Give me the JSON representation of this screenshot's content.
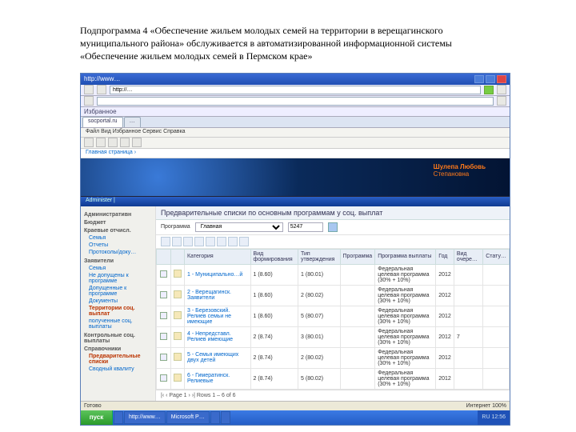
{
  "caption": "Подпрограмма 4 «Обеспечение жильем молодых семей на территории в верещагинского муниципального района»  обслуживается в автоматизированной информационной системы «Обеспечение жильем молодых семей в Пермском крае»",
  "titlebar": "http://www…",
  "address_value": "http://…",
  "fav_label": "Избранное",
  "tabs": [
    "socportal.ru",
    "…"
  ],
  "menubar": "Файл  Вид  Избранное  Сервис  Справка",
  "crumb": "Главная страница  ›",
  "user": {
    "name": "Шулепа Любовь",
    "org": "Степановна"
  },
  "bannermenu": "Administer   |",
  "sidebar": {
    "items": [
      {
        "t": "Административн",
        "sec": true
      },
      {
        "t": "Бюджет",
        "sec": true
      },
      {
        "t": "Краевые отчисл.",
        "sec": true
      },
      {
        "t": "Семья",
        "link": true
      },
      {
        "t": "Отчеты",
        "link": true
      },
      {
        "t": "Протоколы/доку…",
        "link": true
      },
      {
        "t": "Заявители",
        "sec": true
      },
      {
        "t": "Семья",
        "link": true
      },
      {
        "t": "Не допущены к программе",
        "link": true
      },
      {
        "t": "Допущенные к программе",
        "link": true
      },
      {
        "t": "Документы",
        "link": true
      },
      {
        "t": "Территории соц. выплат",
        "sel": true
      },
      {
        "t": "полученные соц. выплаты",
        "link": true
      },
      {
        "t": "Контрольные соц. выплаты",
        "sec": true
      },
      {
        "t": "Справочники",
        "sec": true
      },
      {
        "t": "Предварительные списки",
        "sel": true
      },
      {
        "t": "Сводный квалиту",
        "link": true
      }
    ]
  },
  "main_title": "Предварительные списки по основным программам у соц. выплат",
  "filters": {
    "label1": "Программа",
    "select": "Главная",
    "label2": "",
    "input": "5247",
    "icons": 8
  },
  "columns": [
    "",
    "",
    "Категория",
    "Вид формирования",
    "Тип утверждения",
    "Программа",
    "Программа выплаты",
    "Год",
    "Вид очере…",
    "Стату…"
  ],
  "rows": [
    {
      "cat": "1 - Муниципально…й",
      "vf": "1 (8.60)",
      "tu": "1 (80.01)",
      "prog": "",
      "pv": "Федеральная целевая программа (30% + 10%)",
      "yr": "2012",
      "v": "",
      "s": ""
    },
    {
      "cat": "2 - Верещагинск. Заявители",
      "vf": "1 (8.60)",
      "tu": "2 (80.02)",
      "prog": "",
      "pv": "Федеральная целевая программа (30% + 10%)",
      "yr": "2012",
      "v": "",
      "s": ""
    },
    {
      "cat": "3 - Березовский. Релиев семьи не имеющие",
      "vf": "1 (8.60)",
      "tu": "5 (80.07)",
      "prog": "",
      "pv": "Федеральная целевая программа (30% + 10%)",
      "yr": "2012",
      "v": "",
      "s": ""
    },
    {
      "cat": "4 - Непредставл. Релиев имеющие",
      "vf": "2 (8.74)",
      "tu": "3 (80.01)",
      "prog": "",
      "pv": "Федеральная целевая программа (30% + 10%)",
      "yr": "2012",
      "v": "7",
      "s": ""
    },
    {
      "cat": "5 - Семья имеющих двух детей",
      "vf": "2 (8.74)",
      "tu": "2 (80.02)",
      "prog": "",
      "pv": "Федеральная целевая программа (30% + 10%)",
      "yr": "2012",
      "v": "",
      "s": ""
    },
    {
      "cat": "6 - Гимератинск. Релиевые",
      "vf": "2 (8.74)",
      "tu": "5 (80.02)",
      "prog": "",
      "pv": "Федеральная целевая программа (30% + 10%)",
      "yr": "2012",
      "v": "",
      "s": ""
    }
  ],
  "pager": "|‹ ‹   Page 1   › ›|  Rows 1 – 6 of 6",
  "status_left": "Готово",
  "status_right": "Интернет   100%",
  "start": "пуск",
  "tasks": [
    "",
    "http://www…",
    "Microsoft P…",
    "",
    ""
  ],
  "clock": "RU  12:56"
}
